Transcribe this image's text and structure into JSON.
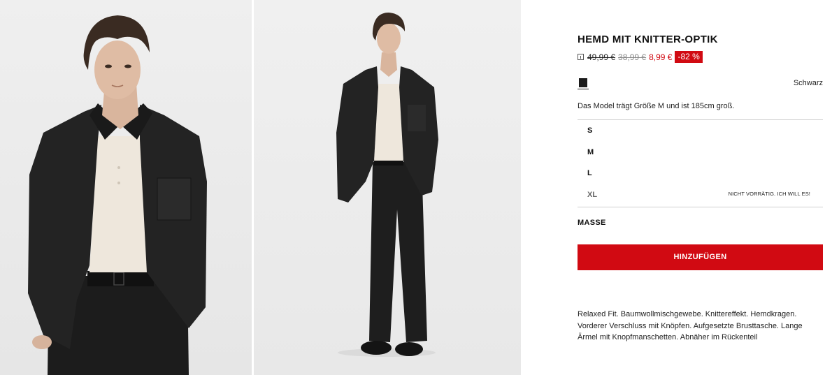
{
  "product": {
    "title": "HEMD MIT KNITTER-OPTIK",
    "prices": {
      "original": "49,99 €",
      "previous": "38,99 €",
      "current": "8,99 €",
      "discount": "-82 %"
    },
    "color": {
      "name": "Schwarz",
      "swatch_hex": "#1a1a1a"
    },
    "model_note": "Das Model trägt Größe M und ist 185cm groß.",
    "sizes": [
      {
        "label": "S",
        "status": ""
      },
      {
        "label": "M",
        "status": ""
      },
      {
        "label": "L",
        "status": ""
      },
      {
        "label": "XL",
        "status": "NICHT VORRÄTIG. ICH WILL ES!"
      }
    ],
    "measurements_label": "MASSE",
    "add_button_label": "HINZUFÜGEN",
    "description": "Relaxed Fit. Baumwollmischgewebe. Knittereffekt. Hemdkragen. Vorderer Verschluss mit Knöpfen. Aufgesetzte Brusttasche. Lange Ärmel mit Knopfmanschetten. Abnäher im Rückenteil"
  },
  "theme": {
    "accent": "#d10a12"
  }
}
